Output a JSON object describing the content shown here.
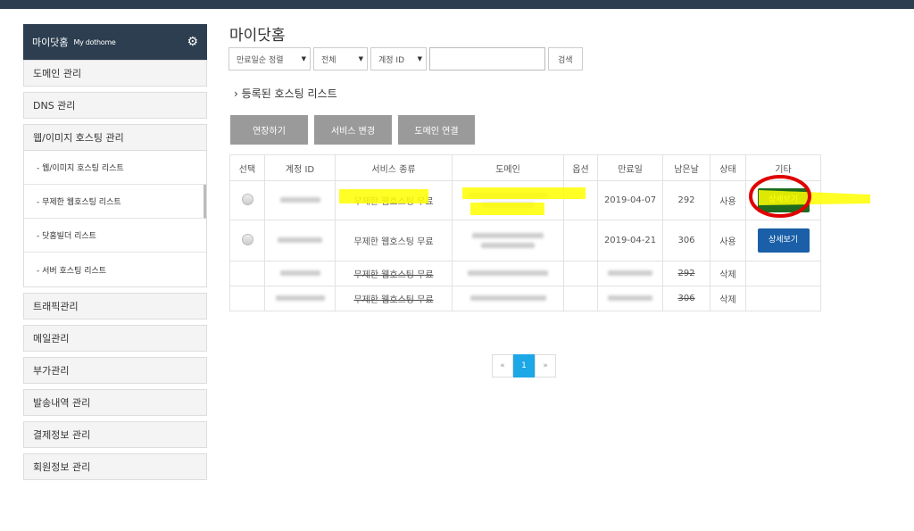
{
  "sidebar": {
    "title": "마이닷홈",
    "subtitle": "My dothome",
    "items": [
      "도메인 관리",
      "DNS 관리",
      "웹/이미지 호스팅 관리"
    ],
    "subitems": [
      "- 웹/이미지 호스팅 리스트",
      "- 무제한 웹호스팅 리스트",
      "- 닷홈빌더 리스트",
      "- 서버 호스팅 리스트"
    ],
    "items2": [
      "트래픽관리",
      "메일관리",
      "부가관리",
      "발송내역 관리",
      "결제정보 관리",
      "회원정보 관리"
    ]
  },
  "page_title": "마이닷홈",
  "filters": {
    "sort": "만료일순 정렬",
    "status": "전체",
    "field": "계정 ID",
    "query": "",
    "search": "검색"
  },
  "section_title": "등록된 호스팅 리스트",
  "actions": [
    "연장하기",
    "서비스 변경",
    "도메인 연결"
  ],
  "table": {
    "headers": [
      "선택",
      "계정 ID",
      "서비스 종류",
      "도메인",
      "옵션",
      "만료일",
      "남은날",
      "상태",
      "기타"
    ],
    "rows": [
      {
        "service": "무제한 웹호스팅 무료",
        "expires": "2019-04-07",
        "days": "292",
        "status": "사용",
        "action": "상세보기"
      },
      {
        "service": "무제한 웹호스팅 무료",
        "expires": "2019-04-21",
        "days": "306",
        "status": "사용",
        "action": "상세보기"
      },
      {
        "service": "무제한 웹호스팅 무료",
        "expires": "",
        "days": "292",
        "status": "삭제"
      },
      {
        "service": "무제한 웹호스팅 무료",
        "expires": "",
        "days": "306",
        "status": "삭제"
      }
    ]
  },
  "pagination": {
    "prev": "«",
    "current": "1",
    "next": "»"
  },
  "colors": {
    "nav": "#2c3e50",
    "detail_button": "#1a5fa8",
    "page_active": "#1ca7e6",
    "highlight": "#ffff00",
    "annotation": "#e00000"
  }
}
